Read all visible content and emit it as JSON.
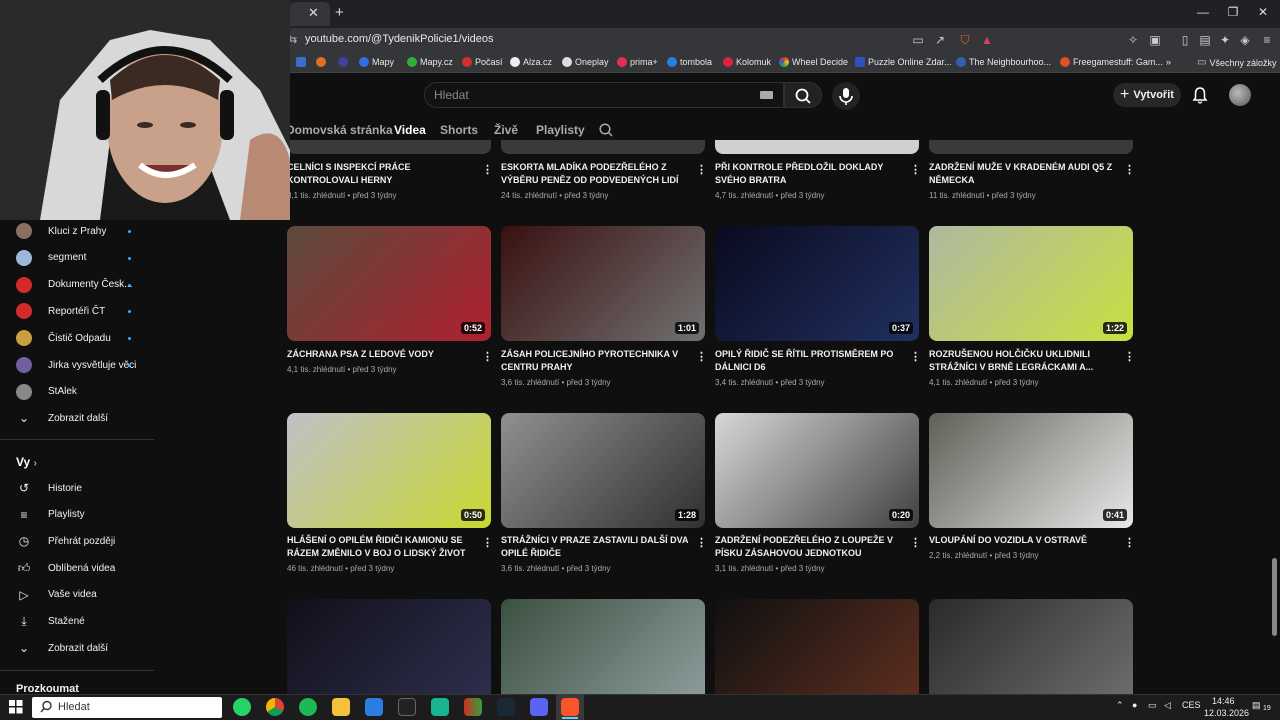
{
  "browser": {
    "url": "youtube.com/@TydenikPolicie1/videos",
    "bookmarks": [
      "Mapy",
      "Mapy.cz",
      "Počasí",
      "Alza.cz",
      "Oneplay",
      "prima+",
      "tombola",
      "Kolomuk",
      "Wheel Decide",
      "Puzzle Online Zdar...",
      "The Neighbourhoo...",
      "Freegamestuff: Gam...",
      "»",
      "Všechny záložky"
    ]
  },
  "header": {
    "search_placeholder": "Hledat",
    "create_label": "Vytvořit"
  },
  "channel_tabs": [
    "Domovská stránka",
    "Videa",
    "Shorts",
    "Živě",
    "Playlisty"
  ],
  "sidebar": {
    "subscriptions": [
      {
        "label": "Kluci z Prahy",
        "color": "#8a7060"
      },
      {
        "label": "segment",
        "color": "#9fb7d9"
      },
      {
        "label": "Dokumenty Česk...",
        "color": "#d42a2a"
      },
      {
        "label": "Reportéři ČT",
        "color": "#d42a2a"
      },
      {
        "label": "Čistič Odpadu",
        "color": "#c8a040"
      },
      {
        "label": "Jirka vysvětluje věci",
        "color": "#7060a0"
      },
      {
        "label": "StAlek",
        "color": "#888888"
      }
    ],
    "show_more_1": "Zobrazit další",
    "you_heading": "Vy",
    "you_items": [
      "Historie",
      "Playlisty",
      "Přehrát později",
      "Oblíbená videa",
      "Vaše videa",
      "Stažené"
    ],
    "show_more_2": "Zobrazit další",
    "explore": "Prozkoumat"
  },
  "videos_top_row": [
    {
      "title": "CELNÍCI S INSPEKCÍ PRÁCE KONTROLOVALI HERNY",
      "views": "8,1 tis. zhlédnutí",
      "age": "před 3 týdny"
    },
    {
      "title": "ESKORTA MLADÍKA PODEZŘELÉHO Z VÝBĚRU PENĚZ OD PODVEDENÝCH LIDÍ",
      "views": "24 tis. zhlédnutí",
      "age": "před 3 týdny"
    },
    {
      "title": "PŘI KONTROLE PŘEDLOŽIL DOKLADY SVÉHO BRATRA",
      "views": "4,7 tis. zhlédnutí",
      "age": "před 3 týdny"
    },
    {
      "title": "ZADRŽENÍ MUŽE V KRADENÉM AUDI Q5 Z NĚMECKA",
      "views": "11 tis. zhlédnutí",
      "age": "před 3 týdny"
    }
  ],
  "videos_row2": [
    {
      "title": "ZÁCHRANA PSA Z LEDOVÉ VODY",
      "views": "4,1 tis. zhlédnutí",
      "age": "před 3 týdny",
      "duration": "0:52",
      "c1": "#5a4a3c",
      "c2": "#b02030"
    },
    {
      "title": "ZÁSAH POLICEJNÍHO PYROTECHNIKA V CENTRU PRAHY",
      "views": "3,6 tis. zhlédnutí",
      "age": "před 3 týdny",
      "duration": "1:01",
      "c1": "#3a1010",
      "c2": "#707070"
    },
    {
      "title": "OPILÝ ŘIDIČ SE ŘÍTIL PROTISMĚREM PO DÁLNICI D6",
      "views": "3,4 tis. zhlédnutí",
      "age": "před 3 týdny",
      "duration": "0:37",
      "c1": "#0a0a1e",
      "c2": "#203060"
    },
    {
      "title": "ROZRUŠENOU HOLČIČKU UKLIDNILI STRÁŽNÍCI V BRNĚ LEGRÁCKAMI A...",
      "views": "4,1 tis. zhlédnutí",
      "age": "před 3 týdny",
      "duration": "1:22",
      "c1": "#b0b8a0",
      "c2": "#c8e040"
    }
  ],
  "videos_row3": [
    {
      "title": "HLÁŠENÍ O OPILÉM ŘIDIČI KAMIONU SE RÁZEM ZMĚNILO V BOJ O LIDSKÝ ŽIVOT",
      "views": "46 tis. zhlédnutí",
      "age": "před 3 týdny",
      "duration": "0:50",
      "c1": "#c0c0c8",
      "c2": "#c8d830"
    },
    {
      "title": "STRÁŽNÍCI V PRAZE ZASTAVILI DALŠÍ DVA OPILÉ ŘIDIČE",
      "views": "3,6 tis. zhlédnutí",
      "age": "před 3 týdny",
      "duration": "1:28",
      "c1": "#909090",
      "c2": "#303030"
    },
    {
      "title": "ZADRŽENÍ PODEZŘELÉHO Z LOUPEŽE V PÍSKU ZÁSAHOVOU JEDNOTKOU",
      "views": "3,1 tis. zhlédnutí",
      "age": "před 3 týdny",
      "duration": "0:20",
      "c1": "#d8d8d8",
      "c2": "#404040"
    },
    {
      "title": "VLOUPÁNÍ DO VOZIDLA V OSTRAVĚ",
      "views": "2,2 tis. zhlédnutí",
      "age": "před 3 týdny",
      "duration": "0:41",
      "c1": "#606058",
      "c2": "#e8e8e8"
    }
  ],
  "videos_row4": [
    {
      "c1": "#10101a",
      "c2": "#303050"
    },
    {
      "c1": "#3a5040",
      "c2": "#90a0a0"
    },
    {
      "c1": "#101010",
      "c2": "#603020"
    },
    {
      "c1": "#2a2a2a",
      "c2": "#707070"
    }
  ],
  "taskbar": {
    "search_placeholder": "Hledat",
    "lang": "CES",
    "time": "14:46",
    "date": "12.03.2026",
    "notif_count": "19"
  }
}
